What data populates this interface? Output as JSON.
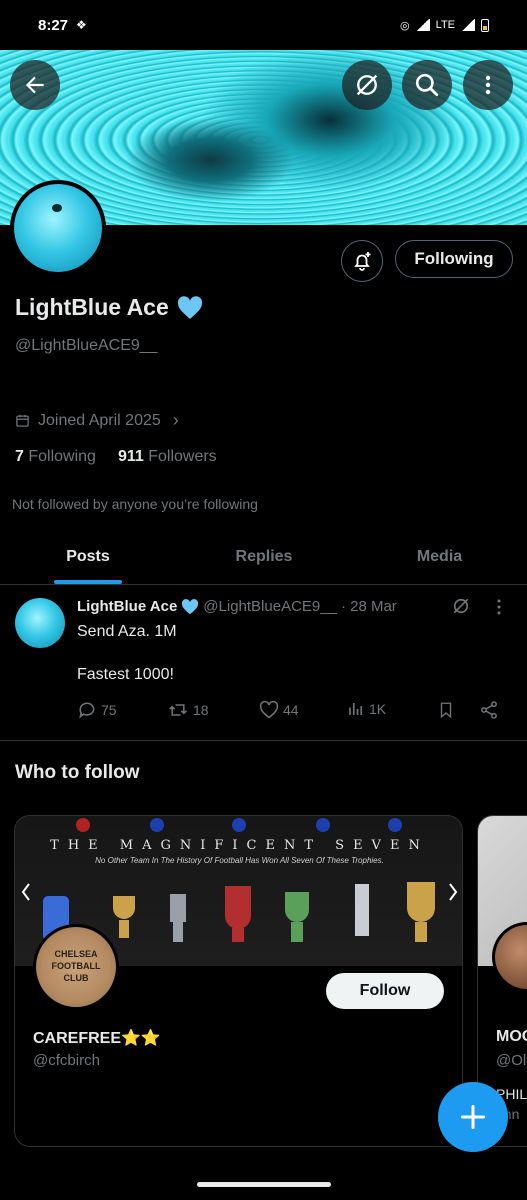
{
  "status_bar": {
    "time": "8:27",
    "network": "LTE"
  },
  "profile": {
    "display_name": "LightBlue Ace",
    "handle": "@LightBlueACE9__",
    "joined": "Joined April 2025",
    "following_count": "7",
    "following_label": "Following",
    "followers_count": "911",
    "followers_label": "Followers",
    "not_followed_text": "Not followed by anyone you’re following",
    "following_button": "Following"
  },
  "tabs": [
    {
      "label": "Posts",
      "active": true
    },
    {
      "label": "Replies",
      "active": false
    },
    {
      "label": "Media",
      "active": false
    }
  ],
  "post": {
    "author": "LightBlue Ace",
    "handle": "@LightBlueACE9__",
    "date": "· 28 Mar",
    "line1": "Send Aza. 1M",
    "line2": "Fastest 1000!",
    "replies": "75",
    "reposts": "18",
    "likes": "44",
    "views": "1K"
  },
  "who_to_follow": {
    "title": "Who to follow",
    "cards": [
      {
        "banner_title": "THE MAGNIFICENT SEVEN",
        "banner_subtitle": "No Other Team In The History Of Football Has Won All Seven Of These Trophies.",
        "avatar_text": "CHELSEA FOOTBALL CLUB",
        "name": "CAREFREE⭐⭐",
        "handle": "@cfcbirch",
        "follow_label": "Follow"
      },
      {
        "name": "MOO",
        "handle": "@Ol",
        "bio_line1": "PHIL",
        "bio_line2": "ohn"
      }
    ]
  },
  "colors": {
    "accent": "#1d9bf0",
    "verified": "#6ec6f5",
    "banner": "#3fe3f0"
  }
}
